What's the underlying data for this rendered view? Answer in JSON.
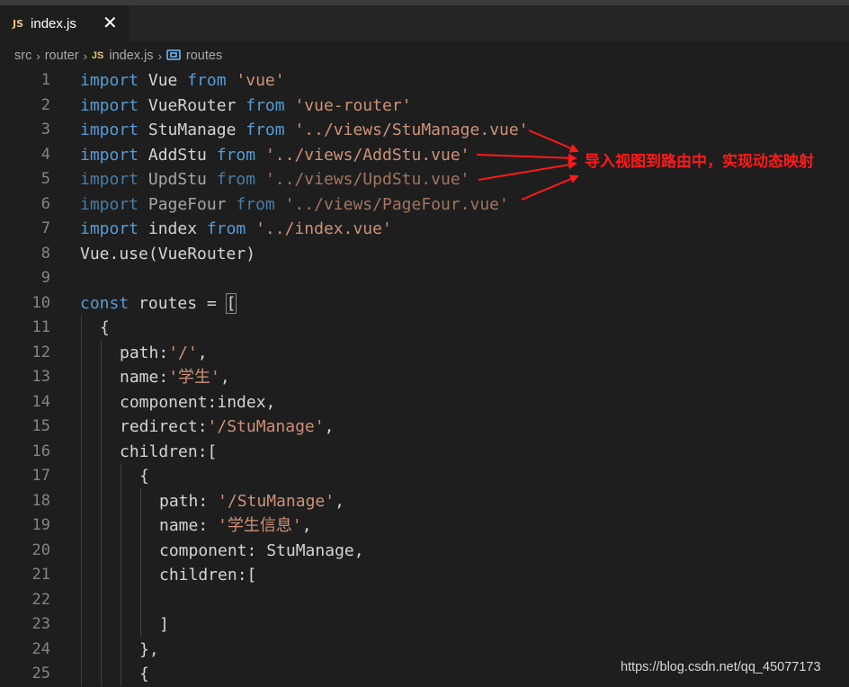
{
  "tab": {
    "badge": "JS",
    "title": "index.js",
    "close_glyph": "✕"
  },
  "breadcrumb": {
    "items": [
      "src",
      "router",
      "index.js",
      "routes"
    ],
    "separator_glyph": "›",
    "file_badge": "JS",
    "symbol_icon": "symbol-variable-icon"
  },
  "code_lines": [
    {
      "n": "1"
    },
    {
      "n": "2"
    },
    {
      "n": "3"
    },
    {
      "n": "4"
    },
    {
      "n": "5"
    },
    {
      "n": "6"
    },
    {
      "n": "7"
    },
    {
      "n": "8"
    },
    {
      "n": "9"
    },
    {
      "n": "10"
    },
    {
      "n": "11"
    },
    {
      "n": "12"
    },
    {
      "n": "13"
    },
    {
      "n": "14"
    },
    {
      "n": "15"
    },
    {
      "n": "16"
    },
    {
      "n": "17"
    },
    {
      "n": "18"
    },
    {
      "n": "19"
    },
    {
      "n": "20"
    },
    {
      "n": "21"
    },
    {
      "n": "22"
    },
    {
      "n": "23"
    },
    {
      "n": "24"
    },
    {
      "n": "25"
    }
  ],
  "code": {
    "l1": [
      "import",
      " Vue ",
      "from",
      " ",
      "'vue'"
    ],
    "l2": [
      "import",
      " VueRouter ",
      "from",
      " ",
      "'vue-router'"
    ],
    "l3": [
      "import",
      " StuManage ",
      "from",
      " ",
      "'../views/StuManage.vue'"
    ],
    "l4": [
      "import",
      " AddStu ",
      "from",
      " ",
      "'../views/AddStu.vue'"
    ],
    "l5": [
      "import",
      " UpdStu ",
      "from",
      " ",
      "'../views/UpdStu.vue'"
    ],
    "l6": [
      "import",
      " PageFour ",
      "from",
      " ",
      "'../views/PageFour.vue'"
    ],
    "l7": [
      "import",
      " index ",
      "from",
      " ",
      "'../index.vue'"
    ],
    "l8": "Vue.use(VueRouter)",
    "l10_kw": "const",
    "l10_rest": " routes = ",
    "l10_bracket": "[",
    "l11": "{",
    "l12_a": "path:",
    "l12_s": "'/'",
    "l12_b": ",",
    "l13_a": "name:",
    "l13_s": "'学生'",
    "l13_b": ",",
    "l14": "component:index,",
    "l15_a": "redirect:",
    "l15_s": "'/StuManage'",
    "l15_b": ",",
    "l16": "children:[",
    "l17": "{",
    "l18_a": "path: ",
    "l18_s": "'/StuManage'",
    "l18_b": ",",
    "l19_a": "name: ",
    "l19_s": "'学生信息'",
    "l19_b": ",",
    "l20": "component: StuManage,",
    "l21": "children:[",
    "l23": "]",
    "l24": "},",
    "l25": "{"
  },
  "annotation": {
    "text": "导入视图到路由中，实现动态映射",
    "color": "#ff1a1a"
  },
  "watermark": "https://blog.csdn.net/qq_45077173",
  "colors": {
    "background": "#1e1e1e",
    "keyword": "#569cd6",
    "string": "#ce9178",
    "identifier": "#d4d4d4",
    "line_number": "#858585",
    "js_badge": "#e5c07b"
  }
}
